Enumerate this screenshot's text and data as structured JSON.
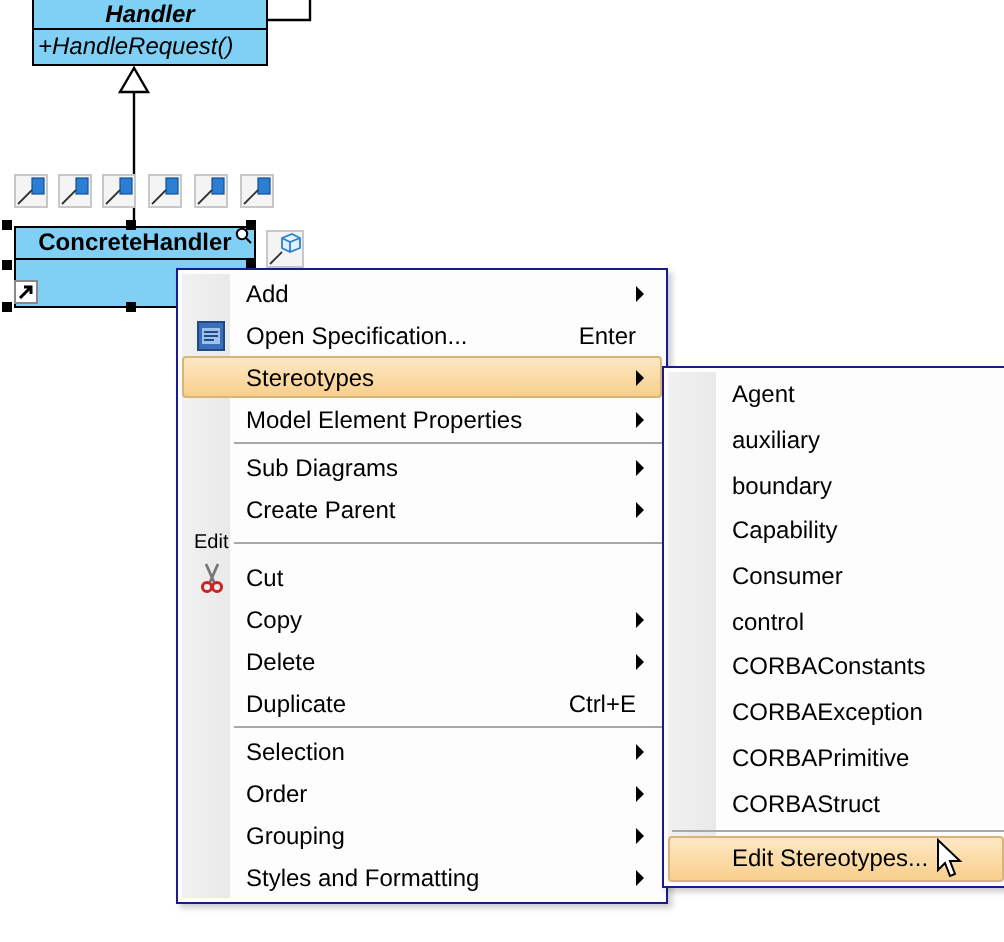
{
  "diagram": {
    "classes": [
      {
        "name": "Handler",
        "operations": [
          "+HandleRequest()"
        ]
      },
      {
        "name": "ConcreteHandler"
      }
    ]
  },
  "context_menu": {
    "items": [
      {
        "kind": "item",
        "label": "Add",
        "submenu": true,
        "selected": false
      },
      {
        "kind": "document",
        "label": "Open Specification...",
        "shortcut": "Enter",
        "submenu": false,
        "selected": false
      },
      {
        "kind": "item",
        "label": "Stereotypes",
        "submenu": true,
        "selected": true
      },
      {
        "kind": "item",
        "label": "Model Element Properties",
        "submenu": true,
        "selected": false
      },
      {
        "kind": "separator"
      },
      {
        "kind": "item",
        "label": "Sub Diagrams",
        "submenu": true,
        "selected": false
      },
      {
        "kind": "item",
        "label": "Create Parent",
        "submenu": true,
        "selected": false
      },
      {
        "kind": "header",
        "label": "Edit"
      },
      {
        "kind": "scissors",
        "label": "Cut",
        "submenu": false,
        "selected": false
      },
      {
        "kind": "item",
        "label": "Copy",
        "submenu": true,
        "selected": false
      },
      {
        "kind": "item",
        "label": "Delete",
        "submenu": true,
        "selected": false
      },
      {
        "kind": "item",
        "label": "Duplicate",
        "shortcut": "Ctrl+E",
        "submenu": false,
        "selected": false
      },
      {
        "kind": "separator"
      },
      {
        "kind": "item",
        "label": "Selection",
        "submenu": true,
        "selected": false
      },
      {
        "kind": "item",
        "label": "Order",
        "submenu": true,
        "selected": false
      },
      {
        "kind": "item",
        "label": "Grouping",
        "submenu": true,
        "selected": false
      },
      {
        "kind": "item",
        "label": "Styles and Formatting",
        "submenu": true,
        "selected": false
      }
    ]
  },
  "stereotypes_submenu": {
    "items": [
      {
        "kind": "item",
        "label": "Agent",
        "selected": false
      },
      {
        "kind": "item",
        "label": "auxiliary",
        "selected": false
      },
      {
        "kind": "item",
        "label": "boundary",
        "selected": false
      },
      {
        "kind": "item",
        "label": "Capability",
        "selected": false
      },
      {
        "kind": "item",
        "label": "Consumer",
        "selected": false
      },
      {
        "kind": "item",
        "label": "control",
        "selected": false
      },
      {
        "kind": "item",
        "label": "CORBAConstants",
        "selected": false
      },
      {
        "kind": "item",
        "label": "CORBAException",
        "selected": false
      },
      {
        "kind": "item",
        "label": "CORBAPrimitive",
        "selected": false
      },
      {
        "kind": "item",
        "label": "CORBAStruct",
        "selected": false
      },
      {
        "kind": "separator"
      },
      {
        "kind": "item",
        "label": "Edit Stereotypes...",
        "selected": true
      }
    ]
  }
}
